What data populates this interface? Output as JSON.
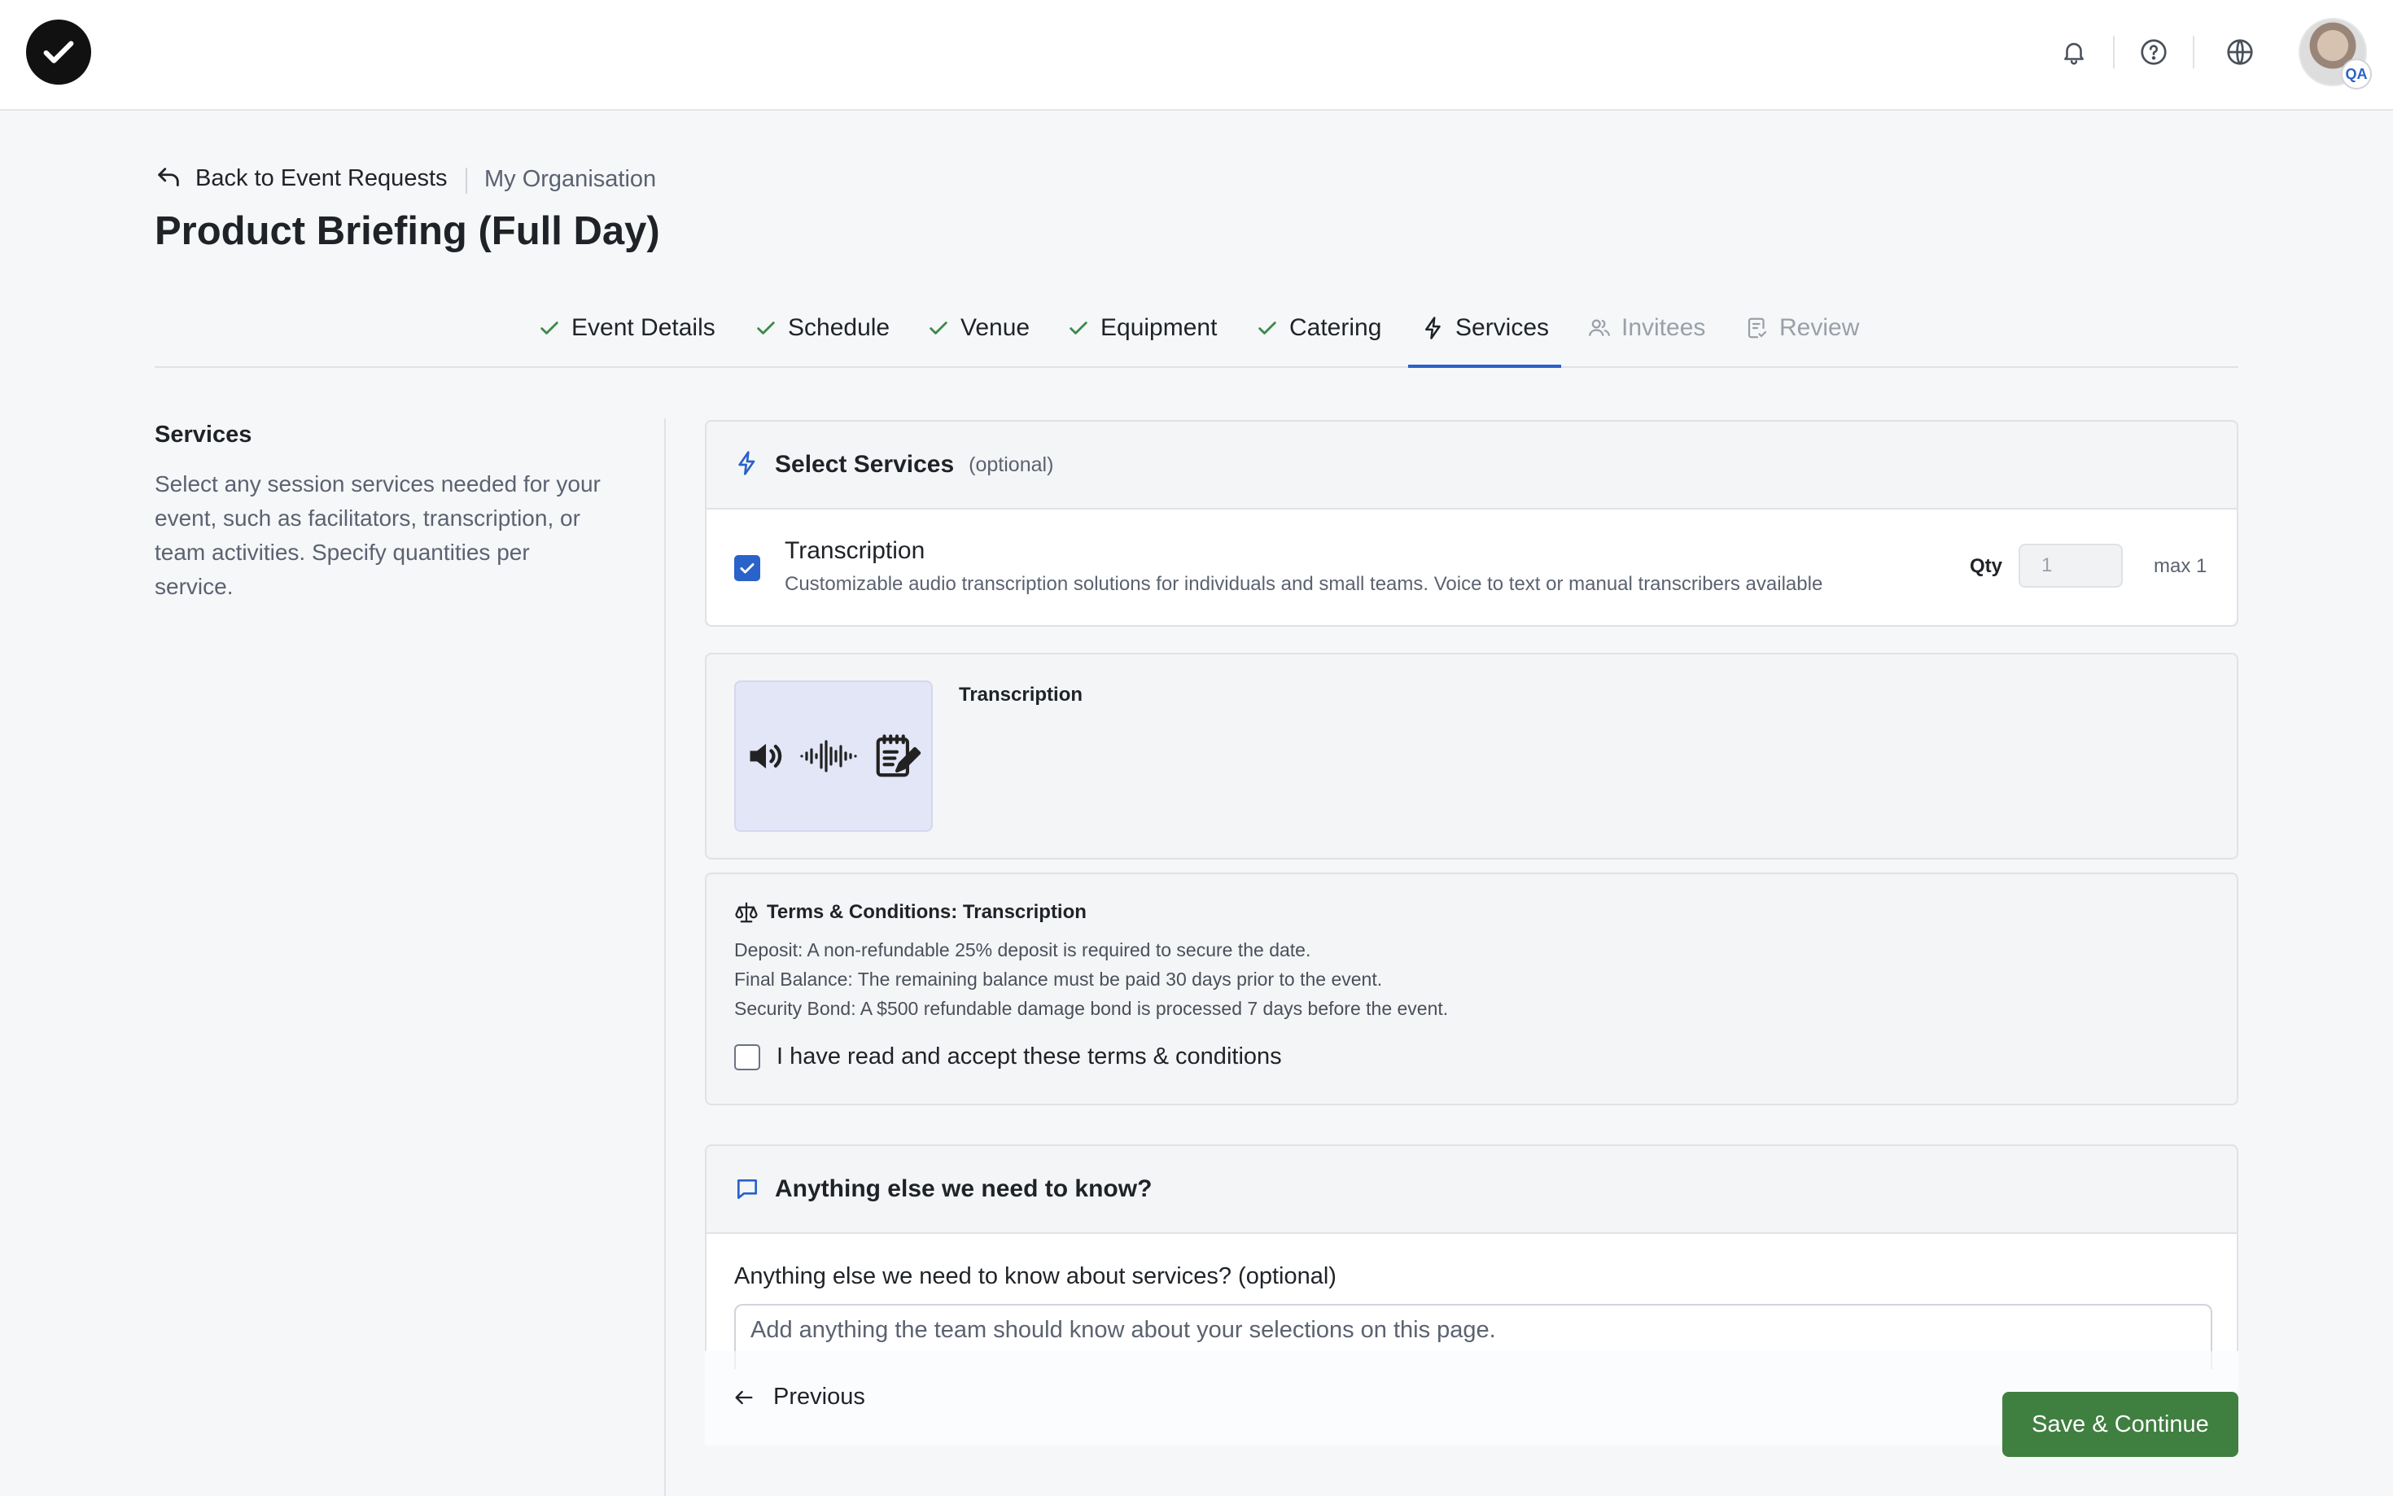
{
  "header": {
    "notifications_icon": "bell-icon",
    "help_icon": "question-circle-icon",
    "language_icon": "globe-icon",
    "avatar_badge": "QA"
  },
  "breadcrumb": {
    "back_label": "Back to Event Requests",
    "org_label": "My Organisation"
  },
  "page": {
    "title": "Product Briefing (Full Day)"
  },
  "tabs": [
    {
      "label": "Event Details",
      "state": "done"
    },
    {
      "label": "Schedule",
      "state": "done"
    },
    {
      "label": "Venue",
      "state": "done"
    },
    {
      "label": "Equipment",
      "state": "done"
    },
    {
      "label": "Catering",
      "state": "done"
    },
    {
      "label": "Services",
      "state": "active"
    },
    {
      "label": "Invitees",
      "state": "disabled"
    },
    {
      "label": "Review",
      "state": "disabled"
    }
  ],
  "sidebar": {
    "title": "Services",
    "description": "Select any session services needed for your event, such as facilitators, transcription, or team activities. Specify quantities per service."
  },
  "select_services": {
    "title": "Select Services",
    "optional": "(optional)",
    "item": {
      "name": "Transcription",
      "description": "Customizable audio transcription solutions for individuals and small teams. Voice to text or manual transcribers available",
      "checked": true,
      "qty_label": "Qty",
      "qty_value": "1",
      "qty_max": "max 1"
    }
  },
  "service_image": {
    "label": "Transcription"
  },
  "terms": {
    "title": "Terms & Conditions: Transcription",
    "lines": [
      "Deposit: A non-refundable 25% deposit is required to secure the date.",
      "Final Balance: The remaining balance must be paid 30 days prior to the event.",
      "Security Bond: A $500 refundable damage bond is processed 7 days before the event."
    ],
    "accept_label": "I have read and accept these terms & conditions"
  },
  "notes": {
    "title": "Anything else we need to know?",
    "label": "Anything else we need to know about services? (optional)",
    "placeholder": "Add anything the team should know about your selections on this page."
  },
  "footer": {
    "previous_label": "Previous",
    "save_label": "Save & Continue"
  },
  "colors": {
    "accent": "#2962c9",
    "success": "#3f7f3f",
    "check": "#3a8a4a"
  }
}
